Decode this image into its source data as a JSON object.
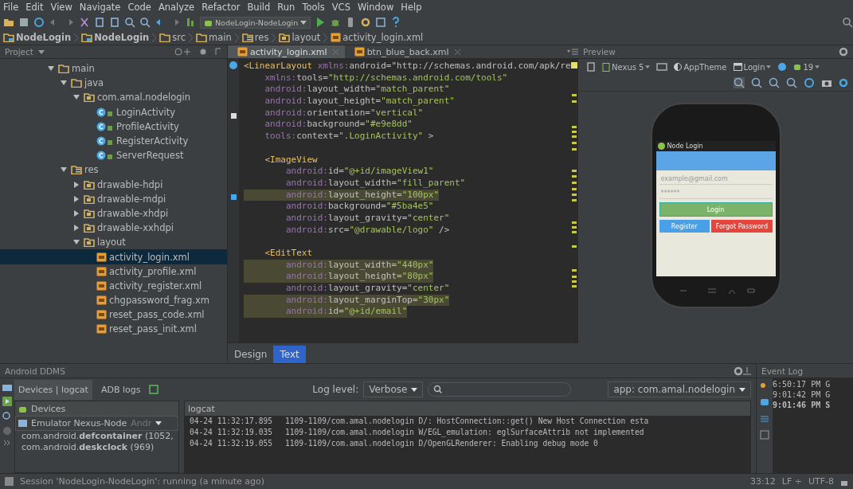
{
  "menu": [
    "File",
    "Edit",
    "View",
    "Navigate",
    "Code",
    "Analyze",
    "Refactor",
    "Build",
    "Run",
    "Tools",
    "VCS",
    "Window",
    "Help"
  ],
  "run_config": "NodeLogin-NodeLogin",
  "breadcrumb": [
    {
      "label": "NodeLogin",
      "kind": "module"
    },
    {
      "label": "NodeLogin",
      "kind": "module"
    },
    {
      "label": "src",
      "kind": "folder"
    },
    {
      "label": "main",
      "kind": "folder"
    },
    {
      "label": "res",
      "kind": "res"
    },
    {
      "label": "layout",
      "kind": "package"
    },
    {
      "label": "activity_login.xml",
      "kind": "xml"
    }
  ],
  "project_panel": {
    "title": "Project",
    "tree": [
      {
        "label": "main",
        "kind": "folder",
        "expanded": true,
        "selected": false,
        "children": [
          {
            "label": "java",
            "kind": "folder",
            "expanded": true,
            "selected": false,
            "children": [
              {
                "label": "com.amal.nodelogin",
                "kind": "package",
                "expanded": true,
                "selected": false,
                "children": [
                  {
                    "label": "LoginActivity",
                    "kind": "class",
                    "selected": false
                  },
                  {
                    "label": "ProfileActivity",
                    "kind": "class",
                    "selected": false
                  },
                  {
                    "label": "RegisterActivity",
                    "kind": "class",
                    "selected": false
                  },
                  {
                    "label": "ServerRequest",
                    "kind": "class",
                    "selected": false
                  }
                ]
              }
            ]
          },
          {
            "label": "res",
            "kind": "res",
            "expanded": true,
            "selected": false,
            "children": [
              {
                "label": "drawable-hdpi",
                "kind": "package",
                "expanded": false,
                "selected": false
              },
              {
                "label": "drawable-mdpi",
                "kind": "package",
                "expanded": false,
                "selected": false
              },
              {
                "label": "drawable-xhdpi",
                "kind": "package",
                "expanded": false,
                "selected": false
              },
              {
                "label": "drawable-xxhdpi",
                "kind": "package",
                "expanded": false,
                "selected": false
              },
              {
                "label": "layout",
                "kind": "package",
                "expanded": true,
                "selected": false,
                "children": [
                  {
                    "label": "activity_login.xml",
                    "kind": "xml",
                    "selected": true
                  },
                  {
                    "label": "activity_profile.xml",
                    "kind": "xml",
                    "selected": false
                  },
                  {
                    "label": "activity_register.xml",
                    "kind": "xml",
                    "selected": false
                  },
                  {
                    "label": "chgpassword_frag.xm",
                    "kind": "xml",
                    "selected": false
                  },
                  {
                    "label": "reset_pass_code.xml",
                    "kind": "xml",
                    "selected": false
                  },
                  {
                    "label": "reset_pass_init.xml",
                    "kind": "xml",
                    "selected": false
                  }
                ]
              }
            ]
          }
        ]
      }
    ]
  },
  "editor": {
    "tabs": [
      {
        "label": "activity_login.xml",
        "selected": true
      },
      {
        "label": "btn_blue_back.xml",
        "selected": false
      }
    ],
    "lines": [
      {
        "text": "<LinearLayout xmlns:android=\"http://schemas.android.com/apk/re",
        "highlighted": false
      },
      {
        "text": "    xmlns:tools=\"http://schemas.android.com/tools\"",
        "highlighted": false
      },
      {
        "text": "    android:layout_width=\"match_parent\"",
        "highlighted": false
      },
      {
        "text": "    android:layout_height=\"match_parent\"",
        "highlighted": false
      },
      {
        "text": "    android:orientation=\"vertical\"",
        "highlighted": false
      },
      {
        "text": "    android:background=\"#e9e8dd\"",
        "highlighted": false
      },
      {
        "text": "    tools:context=\".LoginActivity\" >",
        "highlighted": false
      },
      {
        "kind": "blank"
      },
      {
        "text": "    <ImageView",
        "highlighted": false
      },
      {
        "text": "        android:id=\"@+id/imageView1\"",
        "highlighted": false
      },
      {
        "text": "        android:layout_width=\"fill_parent\"",
        "highlighted": false
      },
      {
        "text": "        android:layout_height=\"100px\"",
        "highlighted": true
      },
      {
        "text": "        android:background=\"#5ba4e5\"",
        "highlighted": false
      },
      {
        "text": "        android:layout_gravity=\"center\"",
        "highlighted": false
      },
      {
        "text": "        android:src=\"@drawable/logo\" />",
        "highlighted": false
      },
      {
        "kind": "blank"
      },
      {
        "text": "    <EditText",
        "highlighted": false
      },
      {
        "text": "        android:layout_width=\"440px\"",
        "highlighted": true
      },
      {
        "text": "        android:layout_height=\"80px\"",
        "highlighted": true
      },
      {
        "text": "        android:layout_gravity=\"center\"",
        "highlighted": false
      },
      {
        "text": "        android:layout_marginTop=\"30px\"",
        "highlighted": true
      },
      {
        "text": "        android:id=\"@+id/email\"",
        "highlighted": true
      }
    ],
    "mode_tabs": [
      {
        "label": "Design",
        "selected": false
      },
      {
        "label": "Text",
        "selected": true
      }
    ]
  },
  "preview": {
    "title": "Preview",
    "device": "Nexus 5",
    "theme": "AppTheme",
    "activity": "Login",
    "api": "19",
    "app": {
      "title": "Node Login",
      "email_placeholder": "example@gmail.com",
      "password": "******",
      "login": "Login",
      "register": "Register",
      "forgot": "Forgot Password"
    }
  },
  "ddms": {
    "title": "Android DDMS",
    "tabs": [
      {
        "label": "Devices | logcat",
        "selected": true
      },
      {
        "label": "ADB logs",
        "selected": false
      }
    ],
    "log_level_label": "Log level:",
    "log_level": "Verbose",
    "filter": "app: com.amal.nodelogin",
    "devices_title": "Devices",
    "device": "Emulator Nexus-Node",
    "device_suffix": "Andr",
    "processes": [
      "com.android.**defcontainer** (1052,",
      "com.android.**deskclock** (969)"
    ],
    "logcat_title": "logcat",
    "log": [
      {
        "time": "04-24 11:32:17.895",
        "message": "1109-1109/com.amal.nodelogin D/: HostConnection::get() New Host Connection esta"
      },
      {
        "time": "04-24 11:32:19.035",
        "message": "1109-1109/com.amal.nodelogin W/EGL_emulation: eglSurfaceAttrib not implemented"
      },
      {
        "time": "04-24 11:32:19.055",
        "message": "1109-1109/com.amal.nodelogin D/OpenGLRenderer: Enabling debug mode 0"
      }
    ]
  },
  "event_log": {
    "title": "Event Log",
    "entries": [
      {
        "text": "6:50:17 PM G",
        "bold": false
      },
      {
        "text": "9:01:42 PM G",
        "bold": false
      },
      {
        "text": "9:01:46 PM S",
        "bold": true
      }
    ]
  },
  "status_bar": {
    "message": "Session 'NodeLogin-NodeLogin': running (a minute ago)",
    "position": "33:12",
    "line_sep": "LF ÷",
    "encoding": "UTF-8"
  }
}
